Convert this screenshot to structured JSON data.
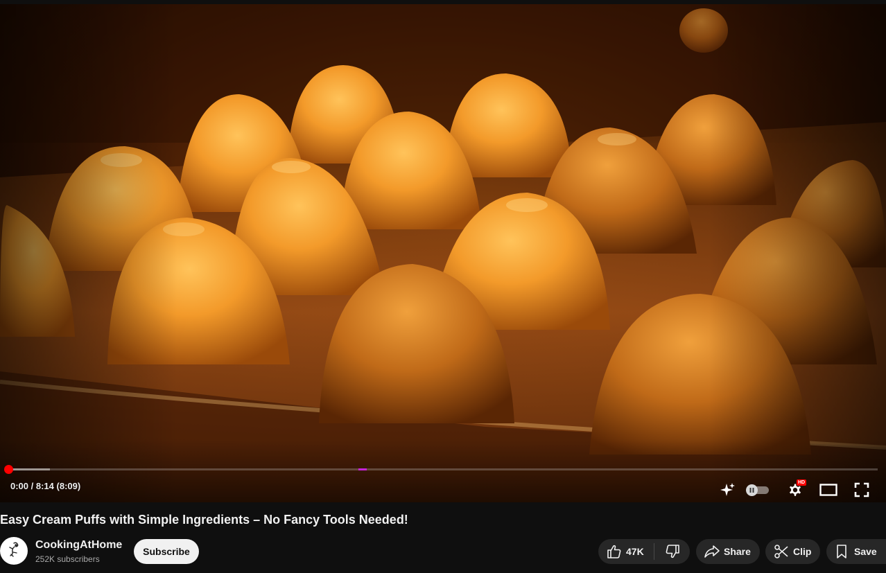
{
  "player": {
    "current_time": "0:00",
    "separator": " / ",
    "duration": "8:14",
    "duration_extra": "(8:09)",
    "progress_played_fraction": 0.0,
    "progress_loaded_fraction": 0.048,
    "quality_badge": "HD",
    "autoplay_on": false
  },
  "video": {
    "title": "Easy Cream Puffs with Simple Ingredients – No Fancy Tools Needed!"
  },
  "channel": {
    "name": "CookingAtHome",
    "subscribers": "252K subscribers",
    "subscribe_label": "Subscribe"
  },
  "actions": {
    "like_count": "47K",
    "share_label": "Share",
    "clip_label": "Clip",
    "save_label": "Save"
  },
  "icons": {
    "autoplay": "sparkle-icon",
    "settings": "gear-icon",
    "theater": "theater-mode-icon",
    "fullscreen": "fullscreen-icon",
    "like": "thumbs-up-icon",
    "dislike": "thumbs-down-icon",
    "share": "share-arrow-icon",
    "clip": "scissors-icon",
    "save": "bookmark-icon"
  },
  "colors": {
    "progress_played": "#ff0000",
    "subscribe_bg": "#f1f1f1",
    "pill_bg": "#272727",
    "page_bg": "#0f0f0f"
  }
}
